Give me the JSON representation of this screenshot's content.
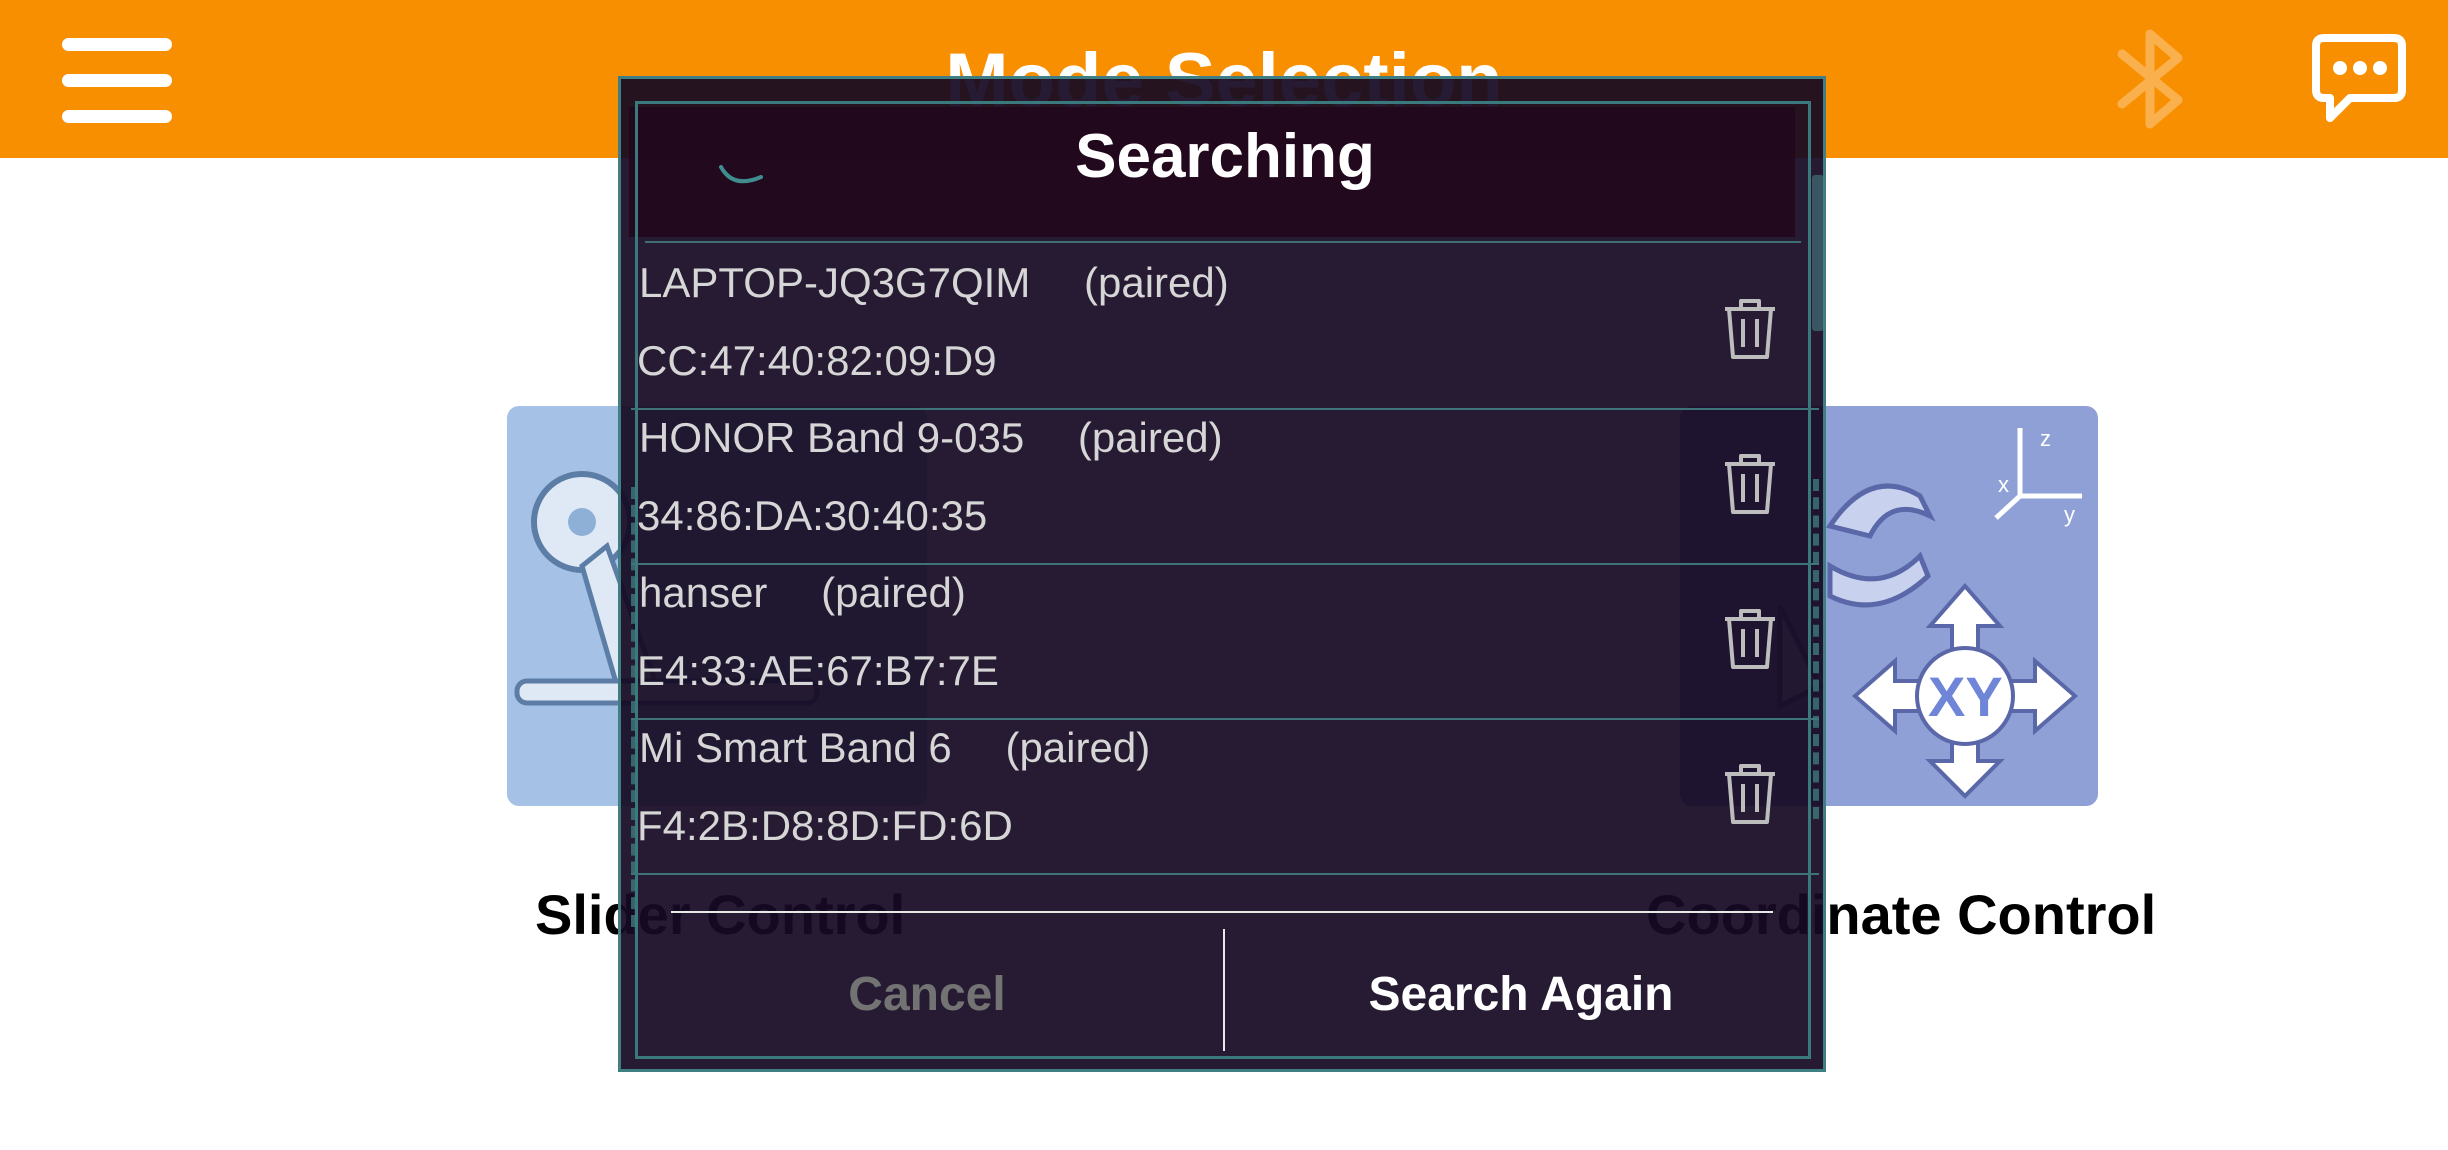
{
  "app_bar": {
    "title": "Mode Selection",
    "menu_icon": "hamburger-menu-icon",
    "bluetooth_icon": "bluetooth-icon",
    "chat_icon": "chat-bubble-icon",
    "background_color": "#f78f00"
  },
  "modes": [
    {
      "label": "Slider Control",
      "image": "robot-arm-slider-illustration"
    },
    {
      "label": "Coordinate Control",
      "image": "robot-arm-xy-axes-illustration"
    }
  ],
  "dialog": {
    "title": "Searching",
    "spinner_icon": "loading-spinner-icon",
    "devices": [
      {
        "name": "LAPTOP-JQ3G7QIM 　(paired)",
        "address": "CC:47:40:82:09:D9"
      },
      {
        "name": "HONOR Band 9-035 　(paired)",
        "address": "34:86:DA:30:40:35"
      },
      {
        "name": "hanser 　(paired)",
        "address": "E4:33:AE:67:B7:7E"
      },
      {
        "name": "Mi Smart Band 6 　(paired)",
        "address": "F4:2B:D8:8D:FD:6D"
      }
    ],
    "delete_icon": "trash-icon",
    "cancel_label": "Cancel",
    "search_again_label": "Search Again"
  }
}
